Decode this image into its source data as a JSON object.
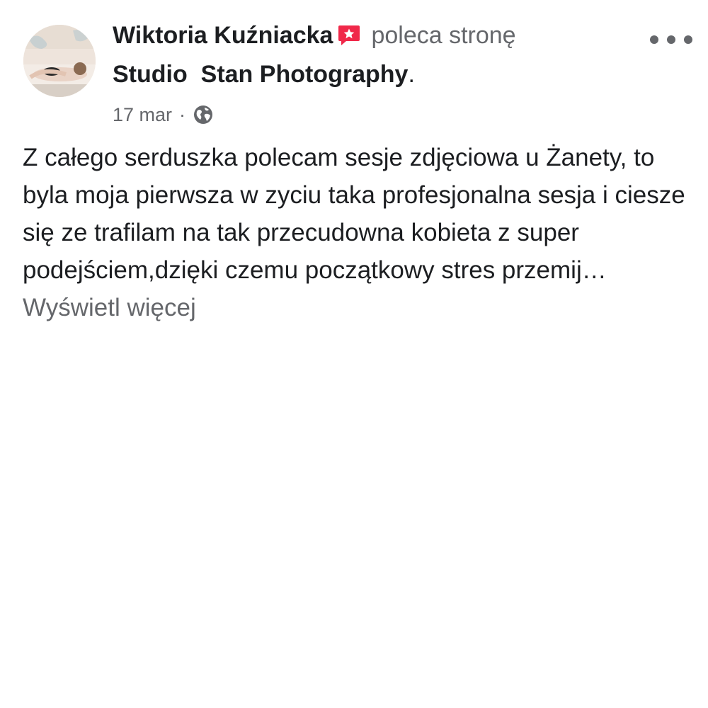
{
  "post": {
    "author_name": "Wiktoria Kuźniacka",
    "action_text": "poleca stronę",
    "page_name": "Studio  Stan Photography",
    "period": ".",
    "date": "17 mar",
    "separator": "·",
    "privacy_icon": "globe-icon",
    "recommend_icon": "recommendation-star-icon",
    "recommend_icon_color": "#f02849",
    "body_text": "Z całego serduszka polecam sesje zdjęciowa u Żanety, to byla moja pierwsza w zyciu taka profesjonalna sesja i ciesze się ze trafilam na tak przecudowna kobieta z super podejściem,dzięki czemu początkowy stres przemij…",
    "see_more": "Wyświetl więcej",
    "more_menu_icon": "more-options-icon"
  }
}
